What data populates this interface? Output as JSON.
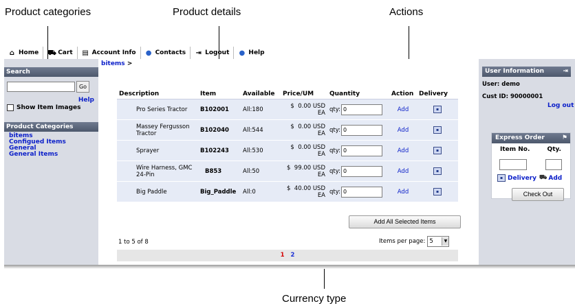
{
  "callouts": {
    "product_categories": "Product categories",
    "product_details": "Product details",
    "actions": "Actions",
    "currency_type": "Currency type"
  },
  "topnav": [
    {
      "label": "Home",
      "icon": "home-icon"
    },
    {
      "label": "Cart",
      "icon": "cart-icon"
    },
    {
      "label": "Account Info",
      "icon": "account-icon"
    },
    {
      "label": "Contacts",
      "icon": "contacts-icon"
    },
    {
      "label": "Logout",
      "icon": "logout-icon"
    },
    {
      "label": "Help",
      "icon": "help-icon"
    }
  ],
  "search": {
    "title": "Search",
    "value": "",
    "go_label": "Go",
    "help_label": "Help",
    "show_images_label": "Show Item Images"
  },
  "categories": {
    "title": "Product Categories",
    "items": [
      "bitems",
      "Configued Items",
      "General",
      "General Items"
    ]
  },
  "breadcrumb": {
    "link": "bitems",
    "sep": ">"
  },
  "grid": {
    "headers": [
      "Description",
      "Item",
      "Available",
      "Price/UM",
      "Quantity",
      "Action",
      "Delivery"
    ],
    "rows": [
      {
        "desc": "Pro Series Tractor",
        "item": "B102001",
        "avail": "All:180",
        "price_cur": "$",
        "price_val": "0.00 USD",
        "price_um": "EA",
        "qty_label": "qty:",
        "qty": "0",
        "action": "Add"
      },
      {
        "desc": "Massey Fergusson Tractor",
        "item": "B102040",
        "avail": "All:544",
        "price_cur": "$",
        "price_val": "0.00 USD",
        "price_um": "EA",
        "qty_label": "qty:",
        "qty": "0",
        "action": "Add"
      },
      {
        "desc": "Sprayer",
        "item": "B102243",
        "avail": "All:530",
        "price_cur": "$",
        "price_val": "0.00 USD",
        "price_um": "EA",
        "qty_label": "qty:",
        "qty": "0",
        "action": "Add"
      },
      {
        "desc": "Wire Harness, GMC 24-Pin",
        "item": "B853",
        "avail": "All:50",
        "price_cur": "$",
        "price_val": "99.00 USD",
        "price_um": "EA",
        "qty_label": "qty:",
        "qty": "0",
        "action": "Add"
      },
      {
        "desc": "Big Paddle",
        "item": "Big_Paddle",
        "avail": "All:0",
        "price_cur": "$",
        "price_val": "40.00 USD",
        "price_um": "EA",
        "qty_label": "qty:",
        "qty": "0",
        "action": "Add"
      }
    ],
    "add_all_label": "Add All Selected Items",
    "range_text": "1 to 5 of 8",
    "per_page_label": "Items per page:",
    "per_page_value": "5",
    "pages": [
      "1",
      "2"
    ]
  },
  "user_info": {
    "title": "User Information",
    "user_line": "User: demo",
    "cust_line": "Cust ID: 90000001",
    "logout_label": "Log out"
  },
  "express": {
    "title": "Express Order",
    "item_no_label": "Item No.",
    "qty_label": "Qty.",
    "delivery_label": "Delivery",
    "add_label": "Add",
    "checkout_label": "Check Out"
  }
}
